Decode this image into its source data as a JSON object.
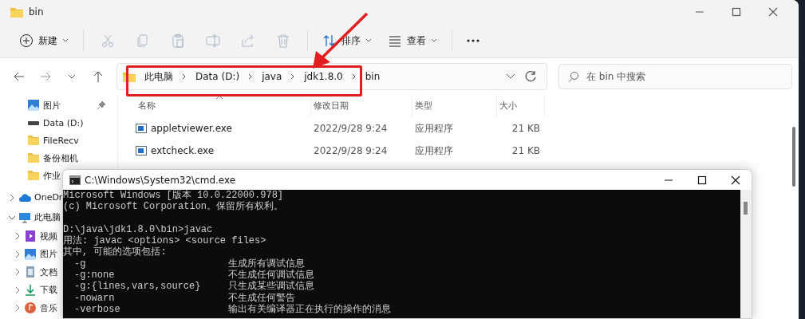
{
  "explorer": {
    "title": "bin",
    "toolbar": [
      {
        "kind": "new",
        "label": "新建",
        "disabled": false
      },
      {
        "kind": "cut",
        "disabled": true
      },
      {
        "kind": "copy",
        "disabled": true
      },
      {
        "kind": "paste",
        "disabled": true
      },
      {
        "kind": "rename",
        "disabled": true
      },
      {
        "kind": "share",
        "disabled": true
      },
      {
        "kind": "delete",
        "disabled": true
      },
      {
        "kind": "sort",
        "label": "排序",
        "disabled": false
      },
      {
        "kind": "view",
        "label": "查看",
        "disabled": false
      },
      {
        "kind": "more",
        "disabled": false
      }
    ],
    "breadcrumb": [
      "此电脑",
      "Data (D:)",
      "java",
      "jdk1.8.0",
      "bin"
    ],
    "search": {
      "placeholder": "在 bin 中搜索"
    },
    "sidebar": {
      "quick_access": [
        {
          "kind": "pictures",
          "label": "图片",
          "pinned": true
        },
        {
          "kind": "drive",
          "label": "Data (D:)",
          "pinned": false
        },
        {
          "kind": "folder",
          "label": "FileRecv",
          "pinned": false
        },
        {
          "kind": "folder",
          "label": "备份相机",
          "pinned": false
        },
        {
          "kind": "folder",
          "label": "作业",
          "pinned": false
        }
      ],
      "tree": [
        {
          "kind": "cloud",
          "label": "OneDr",
          "expanded": false
        },
        {
          "kind": "computer",
          "label": "此电脑",
          "expanded": true,
          "children": [
            {
              "kind": "video",
              "label": "视频",
              "expanded": false
            },
            {
              "kind": "pictures",
              "label": "图片",
              "expanded": false
            },
            {
              "kind": "document",
              "label": "文档",
              "expanded": false
            },
            {
              "kind": "download",
              "label": "下载",
              "expanded": false
            },
            {
              "kind": "music",
              "label": "音乐",
              "expanded": false
            }
          ]
        }
      ]
    },
    "columns": [
      {
        "label": "名称",
        "sorted": true
      },
      {
        "label": "修改日期",
        "sorted": false
      },
      {
        "label": "类型",
        "sorted": false
      },
      {
        "label": "大小",
        "sorted": false
      }
    ],
    "rows": [
      {
        "name": "appletviewer.exe",
        "date": "2022/9/28 9:24",
        "type": "应用程序",
        "size": "21 KB"
      },
      {
        "name": "extcheck.exe",
        "date": "2022/9/28 9:24",
        "type": "应用程序",
        "size": "21 KB"
      }
    ]
  },
  "cmd": {
    "title": "C:\\Windows\\System32\\cmd.exe",
    "lines": [
      {
        "kind": "text",
        "text": "Microsoft Windows [版本 10.0.22000.978]"
      },
      {
        "kind": "text",
        "text": "(c) Microsoft Corporation。保留所有权利。"
      },
      {
        "kind": "blank"
      },
      {
        "kind": "text",
        "text": "D:\\java\\jdk1.8.0\\bin>javac"
      },
      {
        "kind": "text",
        "text": "用法: javac <options> <source files>"
      },
      {
        "kind": "text",
        "text": "其中, 可能的选项包括:"
      },
      {
        "kind": "option",
        "option": "-g",
        "description": "生成所有调试信息"
      },
      {
        "kind": "option",
        "option": "-g:none",
        "description": "不生成任何调试信息"
      },
      {
        "kind": "option",
        "option": "-g:{lines,vars,source}",
        "description": "只生成某些调试信息"
      },
      {
        "kind": "option",
        "option": "-nowarn",
        "description": "不生成任何警告"
      },
      {
        "kind": "option",
        "option": "-verbose",
        "description": "输出有关编译器正在执行的操作的消息"
      }
    ]
  }
}
